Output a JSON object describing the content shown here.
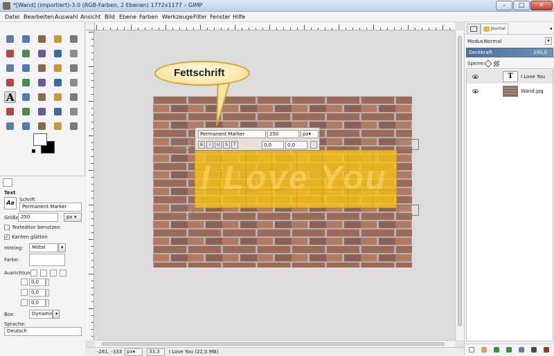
{
  "window": {
    "title": "*[Wand] (importiert)-3.0 (RGB-Farben, 2 Ebenen) 1772x1177 – GIMP",
    "minimize": "–",
    "maximize": "□",
    "close": "✕"
  },
  "menu": [
    "Datei",
    "Bearbeiten",
    "Auswahl",
    "Ansicht",
    "Bild",
    "Ebene",
    "Farben",
    "Werkzeuge",
    "Filter",
    "Fenster",
    "Hilfe"
  ],
  "tool_options": {
    "title": "Text",
    "font_label": "Schrift",
    "font_preview": "Aa",
    "font_value": "Permanent Marker",
    "size_label": "Größe:",
    "size_value": "250",
    "size_unit": "px",
    "text_editor_label": "Texteditor benutzen",
    "antialias_label": "Kanten glätten",
    "hinting_label": "Hinting:",
    "hinting_value": "Mittel",
    "color_label": "Farbe:",
    "justify_label": "Ausrichtung:",
    "indent_value": "0,0",
    "line_spacing_value": "0,0",
    "letter_spacing_value": "0,0",
    "box_label": "Box:",
    "box_value": "Dynamisch",
    "language_label": "Sprache:",
    "language_value": "Deutsch"
  },
  "canvas": {
    "callout": "Fettschrift",
    "text_layer_text": "I Love You",
    "style_editor": {
      "font": "Permanent Marker",
      "size": "250",
      "unit": "px",
      "buttons": [
        "B",
        "I",
        "U",
        "S",
        "T"
      ],
      "baseline": "0,0",
      "kerning": "0,0"
    }
  },
  "status": {
    "coords": "-261, -333",
    "unit": "px",
    "zoom": "33,3 %",
    "message": "I Love You (22,0 MB)"
  },
  "dock": {
    "tab_journal": "Journal",
    "mode_label": "Modus:",
    "mode_value": "Normal",
    "opacity_label": "Deckkraft",
    "opacity_value": "100,0",
    "lock_label": "Sperre:",
    "layers": [
      {
        "name": "I Love You",
        "thumb": "T"
      },
      {
        "name": "Wand.jpg"
      }
    ]
  },
  "colors": {
    "highlight": "#f7c415",
    "selection_blue": "#4a6f9a",
    "callout_border": "#d0a33a"
  }
}
